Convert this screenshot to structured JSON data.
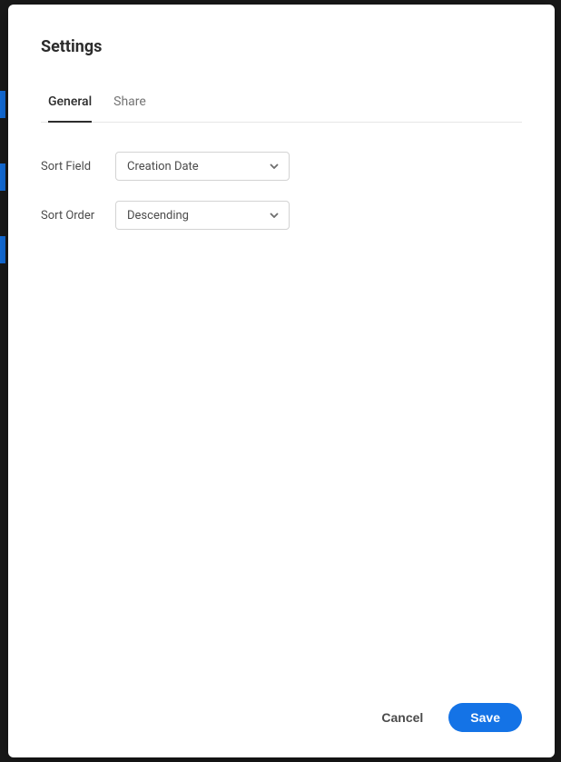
{
  "dialog": {
    "title": "Settings",
    "tabs": {
      "general": "General",
      "share": "Share"
    },
    "form": {
      "sortField": {
        "label": "Sort Field",
        "value": "Creation Date"
      },
      "sortOrder": {
        "label": "Sort Order",
        "value": "Descending"
      }
    },
    "footer": {
      "cancel": "Cancel",
      "save": "Save"
    }
  }
}
